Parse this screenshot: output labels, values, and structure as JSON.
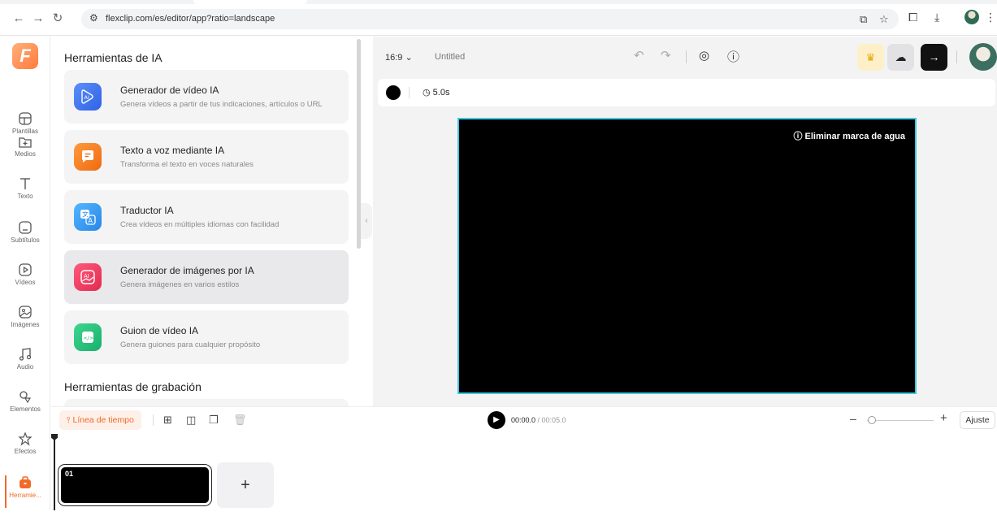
{
  "browser": {
    "url": "flexclip.com/es/editor/app?ratio=landscape",
    "back_icon": "arrow-left-icon",
    "forward_icon": "arrow-right-icon",
    "reload_icon": "reload-icon"
  },
  "rail": {
    "logo": "F",
    "items": [
      {
        "label": "Plantillas",
        "icon": "templates-icon"
      },
      {
        "label": "Medios",
        "icon": "media-icon"
      },
      {
        "label": "Texto",
        "icon": "text-icon"
      },
      {
        "label": "Subtítulos",
        "icon": "subtitles-icon"
      },
      {
        "label": "Vídeos",
        "icon": "video-icon"
      },
      {
        "label": "Imágenes",
        "icon": "image-icon"
      },
      {
        "label": "Audio",
        "icon": "music-icon"
      },
      {
        "label": "Elementos",
        "icon": "elements-icon"
      },
      {
        "label": "Efectos",
        "icon": "effects-icon"
      },
      {
        "label": "Herramie...",
        "icon": "toolbox-icon"
      }
    ]
  },
  "panel": {
    "section1": "Herramientas de IA",
    "section2": "Herramientas de grabación",
    "cards": [
      {
        "title": "Generador de vídeo IA",
        "desc": "Genera vídeos a partir de tus indicaciones, artículos o URL",
        "color": "#3d7bf5"
      },
      {
        "title": "Texto a voz mediante IA",
        "desc": "Transforma el texto en voces naturales",
        "color": "#f27a22"
      },
      {
        "title": "Traductor IA",
        "desc": "Crea vídeos en múltiples idiomas con facilidad",
        "color": "#3aa0f0"
      },
      {
        "title": "Generador de imágenes por IA",
        "desc": "Genera imágenes en varios estilos",
        "color": "#e8345a"
      },
      {
        "title": "Guion de vídeo IA",
        "desc": "Genera guiones para cualquier propósito",
        "color": "#25c17a"
      }
    ]
  },
  "editor": {
    "ratio": "16:9",
    "title": "Untitled",
    "duration": "5.0s",
    "watermark": "Eliminar marca de agua",
    "canvas_color": "#000000",
    "accent": "#3fc6e0"
  },
  "timeline": {
    "tab": "Línea de tiempo",
    "current_time": "00:00.0",
    "total_time": "/ 00:05.0",
    "fit": "Ajuste",
    "clip_number": "01",
    "add_symbol": "+"
  }
}
